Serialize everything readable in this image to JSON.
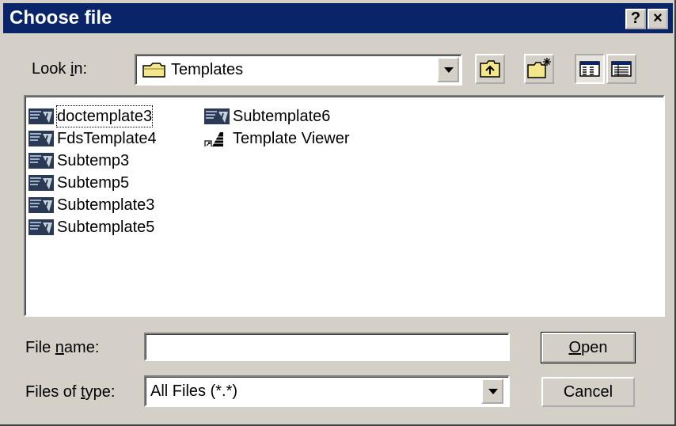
{
  "window": {
    "title": "Choose file",
    "help_label": "?",
    "close_label": "×"
  },
  "look_in": {
    "label_pre": "Look ",
    "label_key": "i",
    "label_post": "n:",
    "value": "Templates"
  },
  "toolbar": [
    {
      "icon": "up-folder-icon"
    },
    {
      "icon": "new-folder-icon"
    },
    {
      "icon": "list-view-icon",
      "pressed": true
    },
    {
      "icon": "details-view-icon"
    }
  ],
  "files": [
    {
      "name": "doctemplate3",
      "icon": "template-icon",
      "focused": true
    },
    {
      "name": "FdsTemplate4",
      "icon": "template-icon"
    },
    {
      "name": "Subtemp3",
      "icon": "template-icon"
    },
    {
      "name": "Subtemp5",
      "icon": "template-icon"
    },
    {
      "name": "Subtemplate3",
      "icon": "template-icon"
    },
    {
      "name": "Subtemplate5",
      "icon": "template-icon"
    },
    {
      "name": "Subtemplate6",
      "icon": "template-icon"
    },
    {
      "name": "Template Viewer",
      "icon": "shortcut-icon"
    }
  ],
  "file_name": {
    "label_pre": "File ",
    "label_key": "n",
    "label_post": "ame:",
    "value": ""
  },
  "file_type": {
    "label_pre": "Files of ",
    "label_key": "t",
    "label_post": "ype:",
    "value": "All Files (*.*)"
  },
  "buttons": {
    "open_key": "O",
    "open_rest": "pen",
    "cancel": "Cancel"
  },
  "colors": {
    "titlebar": "#0a246a",
    "face": "#d4d0c8",
    "window": "#ffffff"
  }
}
